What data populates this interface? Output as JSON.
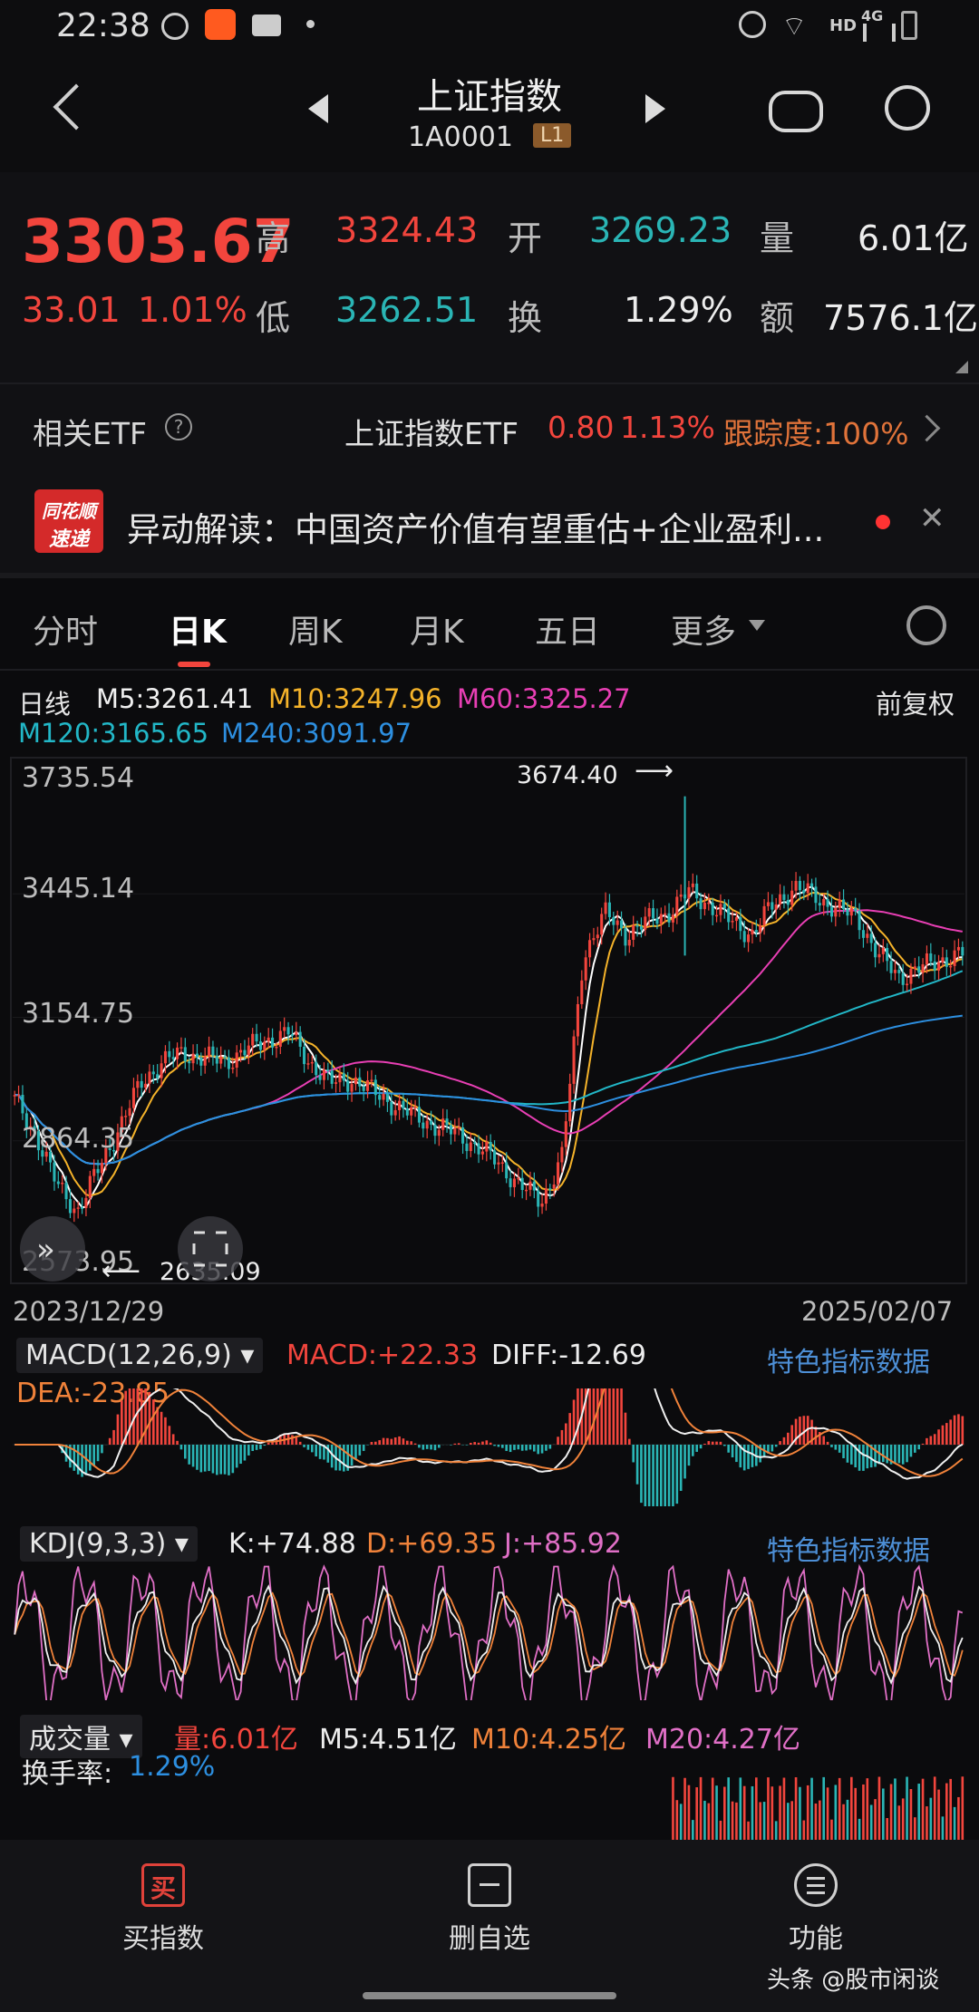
{
  "status_bar": {
    "time": "22:38",
    "network": "HD",
    "signal": "4G"
  },
  "header": {
    "title": "上证指数",
    "code": "1A0001",
    "level": "L1"
  },
  "quote": {
    "price": "3303.67",
    "change": "33.01",
    "change_pct": "1.01%",
    "high_label": "高",
    "high": "3324.43",
    "open_label": "开",
    "open": "3269.23",
    "volume_label": "量",
    "volume": "6.01亿",
    "low_label": "低",
    "low": "3262.51",
    "turnover_label": "换",
    "turnover": "1.29%",
    "amount_label": "额",
    "amount": "7576.1亿"
  },
  "etf": {
    "label": "相关ETF",
    "name": "上证指数ETF",
    "price": "0.80",
    "pct": "1.13%",
    "tracking": "跟踪度:100%"
  },
  "news": {
    "badge_top": "同花顺",
    "badge_bottom": "速递",
    "text": "异动解读：中国资产价值有望重估+企业盈利..."
  },
  "tabs": [
    {
      "label": "分时"
    },
    {
      "label": "日K"
    },
    {
      "label": "周K"
    },
    {
      "label": "月K"
    },
    {
      "label": "五日"
    },
    {
      "label": "更多"
    }
  ],
  "active_tab": "日K",
  "ma_legend": {
    "period": "日线",
    "m5": "M5:3261.41",
    "m10": "M10:3247.96",
    "m60": "M60:3325.27",
    "m120": "M120:3165.65",
    "m240": "M240:3091.97",
    "adjust": "前复权"
  },
  "kline_axis": {
    "y_ticks": [
      "3735.54",
      "3445.14",
      "3154.75",
      "2864.35",
      "2573.95"
    ],
    "max_label": "3674.40",
    "min_label": "2635.09",
    "start_date": "2023/12/29",
    "end_date": "2025/02/07"
  },
  "macd": {
    "name": "MACD(12,26,9)",
    "macd": "MACD:+22.33",
    "diff": "DIFF:-12.69",
    "dea": "DEA:-23.85",
    "feature": "特色指标数据"
  },
  "kdj": {
    "name": "KDJ(9,3,3)",
    "k": "K:+74.88",
    "d": "D:+69.35",
    "j": "J:+85.92",
    "feature": "特色指标数据"
  },
  "volume": {
    "name": "成交量",
    "vol": "量:6.01亿",
    "m5": "M5:4.51亿",
    "m10": "M10:4.25亿",
    "m20": "M20:4.27亿",
    "turnover_label": "换手率:",
    "turnover": "1.29%"
  },
  "bottom_nav": [
    {
      "label": "买指数",
      "icon": "buy-icon",
      "glyph": "买"
    },
    {
      "label": "删自选",
      "icon": "remove-watchlist-icon"
    },
    {
      "label": "功能",
      "icon": "menu-icon"
    }
  ],
  "watermark": "头条 @股市闲谈",
  "colors": {
    "up": "#f2453d",
    "down": "#2ab5b5",
    "m5": "#ffffff",
    "m10": "#f5b32a",
    "m60": "#e83fb4",
    "m120": "#22b7c7",
    "m240": "#2d8fe0"
  },
  "chart_data": [
    {
      "type": "candlestick",
      "title": "上证指数 日K",
      "x_range": [
        "2023/12/29",
        "2025/02/07"
      ],
      "ylim": [
        2573.95,
        3735.54
      ],
      "high_point": 3674.4,
      "low_point": 2635.09,
      "close_path": [
        2960,
        2880,
        2760,
        2700,
        2800,
        2900,
        3000,
        3050,
        3070,
        3060,
        3050,
        3080,
        3100,
        3120,
        3050,
        3000,
        3010,
        2980,
        2950,
        2920,
        2900,
        2880,
        2850,
        2810,
        2760,
        2720,
        2830,
        3300,
        3400,
        3350,
        3380,
        3400,
        3450,
        3420,
        3380,
        3350,
        3420,
        3460,
        3440,
        3410,
        3390,
        3300,
        3250,
        3270,
        3290,
        3303.67
      ],
      "series": [
        {
          "name": "M5",
          "last": 3261.41
        },
        {
          "name": "M10",
          "last": 3247.96
        },
        {
          "name": "M60",
          "last": 3325.27
        },
        {
          "name": "M120",
          "last": 3165.65
        },
        {
          "name": "M240",
          "last": 3091.97
        }
      ]
    },
    {
      "type": "bar",
      "title": "MACD(12,26,9)",
      "values": {
        "MACD": 22.33,
        "DIFF": -12.69,
        "DEA": -23.85
      }
    },
    {
      "type": "line",
      "title": "KDJ(9,3,3)",
      "values": {
        "K": 74.88,
        "D": 69.35,
        "J": 85.92
      }
    },
    {
      "type": "bar",
      "title": "成交量",
      "values": {
        "量": "6.01亿",
        "M5": "4.51亿",
        "M10": "4.25亿",
        "M20": "4.27亿"
      }
    }
  ]
}
